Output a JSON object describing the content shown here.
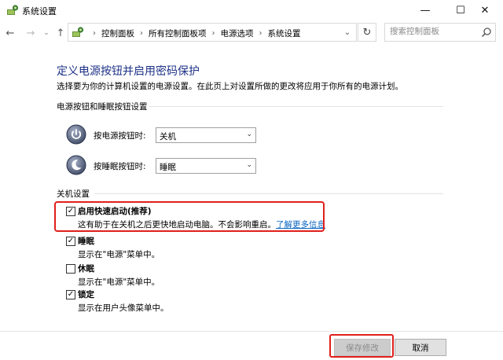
{
  "window": {
    "title": "系统设置",
    "minimize_glyph": "—",
    "maximize_glyph": "☐",
    "close_glyph": "✕"
  },
  "navigation": {
    "back_glyph": "←",
    "forward_glyph": "→",
    "recent_glyph": "⌄",
    "up_glyph": "↑",
    "breadcrumbs": [
      "控制面板",
      "所有控制面板项",
      "电源选项",
      "系统设置"
    ],
    "separator": "›",
    "dropdown_glyph": "⌄",
    "refresh_glyph": "↻",
    "search_placeholder": "搜索控制面板"
  },
  "page": {
    "title": "定义电源按钮并启用密码保护",
    "description": "选择要为你的计算机设置的电源设置。在此页上对设置所做的更改将应用于你所有的电源计划。"
  },
  "power_section": {
    "title": "电源按钮和睡眠按钮设置",
    "power_button": {
      "label": "按电源按钮时:",
      "value": "关机"
    },
    "sleep_button": {
      "label": "按睡眠按钮时:",
      "value": "睡眠"
    }
  },
  "shutdown_section": {
    "title": "关机设置",
    "options": [
      {
        "label": "启用快速启动(推荐)",
        "desc": "这有助于在关机之后更快地启动电脑。不会影响重启。",
        "link": "了解更多信息",
        "checked": true
      },
      {
        "label": "睡眠",
        "desc": "显示在\"电源\"菜单中。",
        "checked": true
      },
      {
        "label": "休眠",
        "desc": "显示在\"电源\"菜单中。",
        "checked": false
      },
      {
        "label": "锁定",
        "desc": "显示在用户头像菜单中。",
        "checked": true
      }
    ]
  },
  "footer": {
    "save_label": "保存修改",
    "cancel_label": "取消"
  },
  "colors": {
    "heading": "#1e3287",
    "link": "#0b66c3",
    "highlight": "#e0201b"
  }
}
